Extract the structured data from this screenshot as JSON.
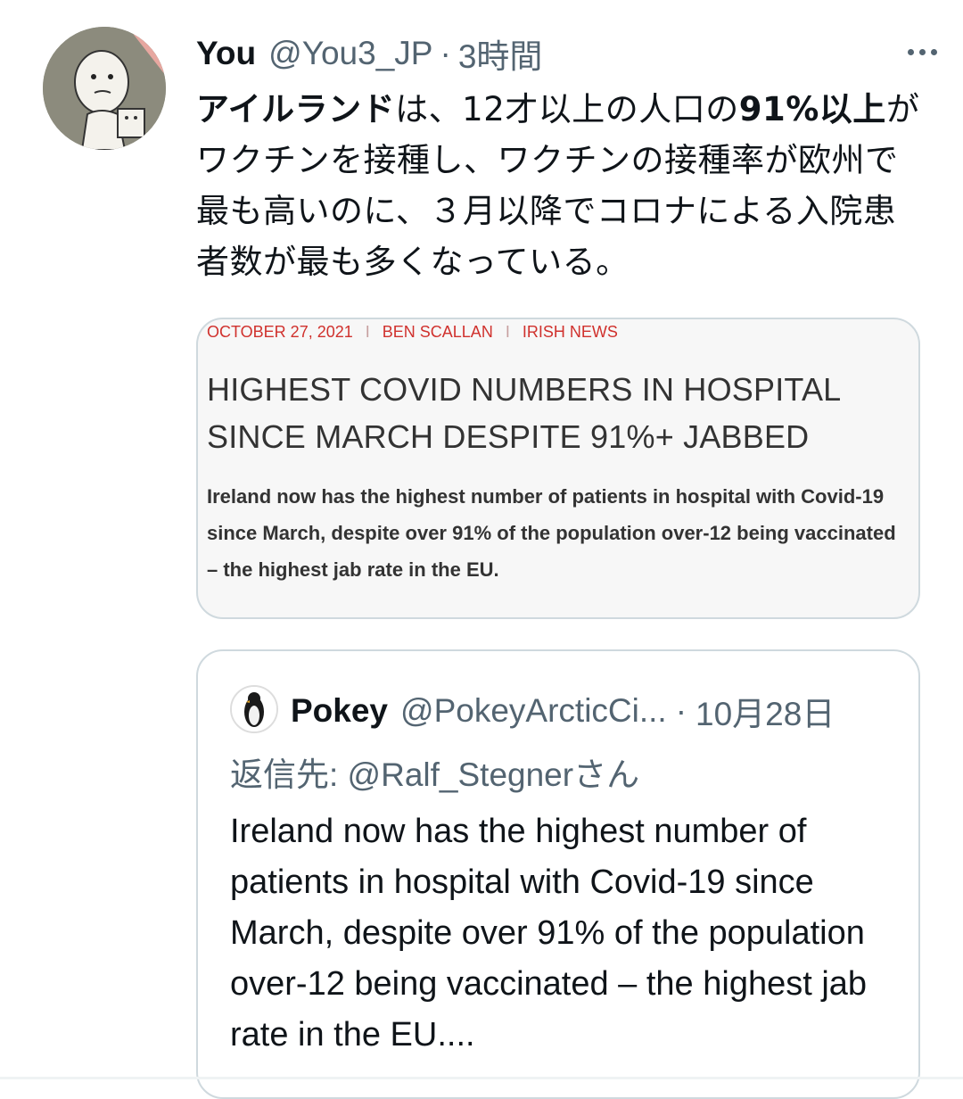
{
  "tweet": {
    "author_name": "You",
    "author_handle": "@You3_JP",
    "separator": "·",
    "time": "3時間",
    "text_parts": {
      "p1_bold": "アイルランド",
      "p2": "は、12才以上の人口の",
      "p3_bold": "91%以上",
      "p4": "がワクチンを接種し、ワクチンの接種率が欧州で最も高いのに、３月以降でコロナによる入院患者数が最も多くなっている。"
    }
  },
  "card": {
    "date": "OCTOBER 27, 2021",
    "author": "BEN SCALLAN",
    "section": "IRISH NEWS",
    "divider": "I",
    "headline": "HIGHEST COVID NUMBERS IN HOSPITAL SINCE MARCH DESPITE 91%+ JABBED",
    "body": "Ireland now has the highest number of patients in hospital with Covid-19 since March, despite over 91% of the population over-12 being vaccinated – the highest jab rate in the EU."
  },
  "quoted_tweet": {
    "author_name": "Pokey",
    "author_handle": "@PokeyArcticCi...",
    "separator": "·",
    "date": "10月28日",
    "reply_to": "返信先: @Ralf_Stegnerさん",
    "text": "Ireland now has the highest number of patients in hospital with Covid-19 since March, despite over 91% of the population over-12 being vaccinated – the highest jab rate in the EU...."
  },
  "icons": {
    "more": "more-icon",
    "avatar": "cartoon-avatar",
    "quoted_avatar": "penguin-avatar"
  }
}
